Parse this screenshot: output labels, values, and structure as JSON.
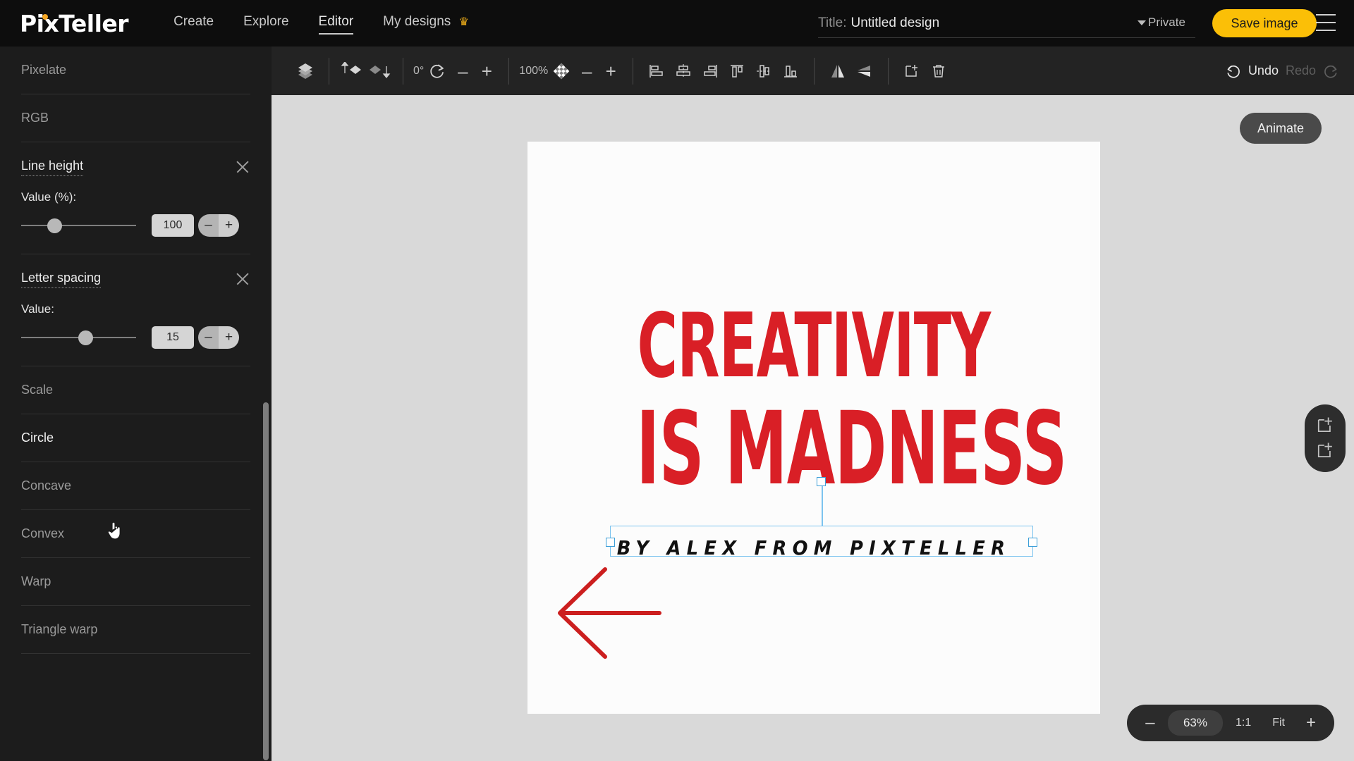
{
  "app": {
    "logo": "PixTeller",
    "nav": [
      {
        "label": "Create",
        "active": false
      },
      {
        "label": "Explore",
        "active": false
      },
      {
        "label": "Editor",
        "active": true
      },
      {
        "label": "My designs",
        "active": false,
        "badge_icon": "crown-icon"
      }
    ],
    "title_label": "Title:",
    "title_value": "Untitled design",
    "title_placeholder": "Untitled design",
    "privacy": "Private",
    "save_label": "Save image",
    "menu_icon": "hamburger-menu-icon",
    "accent_color": "#fbbf07",
    "crown_color": "#f5b21a"
  },
  "sidebar": {
    "rows_top": [
      {
        "label": "Pixelate",
        "state": "normal"
      },
      {
        "label": "RGB",
        "state": "normal"
      }
    ],
    "sections": [
      {
        "title": "Line height",
        "close_icon": "close-icon",
        "field_label": "Value (%):",
        "value": "100",
        "slider_pct": 26,
        "minus": "–",
        "plus": "+"
      },
      {
        "title": "Letter spacing",
        "close_icon": "close-icon",
        "field_label": "Value:",
        "value": "15",
        "slider_pct": 57,
        "minus": "–",
        "plus": "+"
      }
    ],
    "rows_bottom": [
      {
        "label": "Scale",
        "state": "normal"
      },
      {
        "label": "Circle",
        "state": "highlighted"
      },
      {
        "label": "Concave",
        "state": "normal"
      },
      {
        "label": "Convex",
        "state": "normal"
      },
      {
        "label": "Warp",
        "state": "normal"
      },
      {
        "label": "Triangle warp",
        "state": "normal"
      }
    ]
  },
  "toolbar": {
    "layers_icon": "layers-icon",
    "bring_forward_icon": "bring-forward-icon",
    "send_backward_icon": "send-backward-icon",
    "rotation_value": "0°",
    "rotation_icon": "rotate-icon",
    "rotation_minus": "–",
    "rotation_plus": "+",
    "opacity_value": "100%",
    "opacity_icon": "opacity-checker-icon",
    "opacity_minus": "–",
    "opacity_plus": "+",
    "align_icons": [
      "align-left-icon",
      "align-center-horizontal-icon",
      "align-right-icon",
      "align-top-icon",
      "align-center-vertical-icon",
      "align-bottom-icon"
    ],
    "flip_icons": [
      "flip-horizontal-icon",
      "flip-vertical-icon"
    ],
    "duplicate_icon": "duplicate-icon",
    "delete_icon": "trash-icon",
    "undo_label": "Undo",
    "undo_icon": "undo-arrow-icon",
    "redo_label": "Redo",
    "redo_icon": "redo-arrow-icon",
    "redo_disabled": true
  },
  "canvas": {
    "background": "#d9d9d9",
    "artboard_color": "#fcfcfc",
    "headline_color": "#d91f26",
    "headline_line1": "CREATIVITY",
    "headline_line2": "IS MADNESS",
    "subline": "BY ALEX FROM PIXTELLER",
    "selection_color": "#7cc3ef",
    "annotation": {
      "type": "arrow",
      "direction": "left",
      "color": "#cc1f1f"
    }
  },
  "right_rail": {
    "animate_label": "Animate",
    "add_frame_icon": "add-frame-icon",
    "duplicate_frame_icon": "duplicate-frame-icon"
  },
  "zoom_bar": {
    "minus": "–",
    "percent": "63%",
    "one_to_one": "1:1",
    "fit": "Fit",
    "plus": "+"
  }
}
